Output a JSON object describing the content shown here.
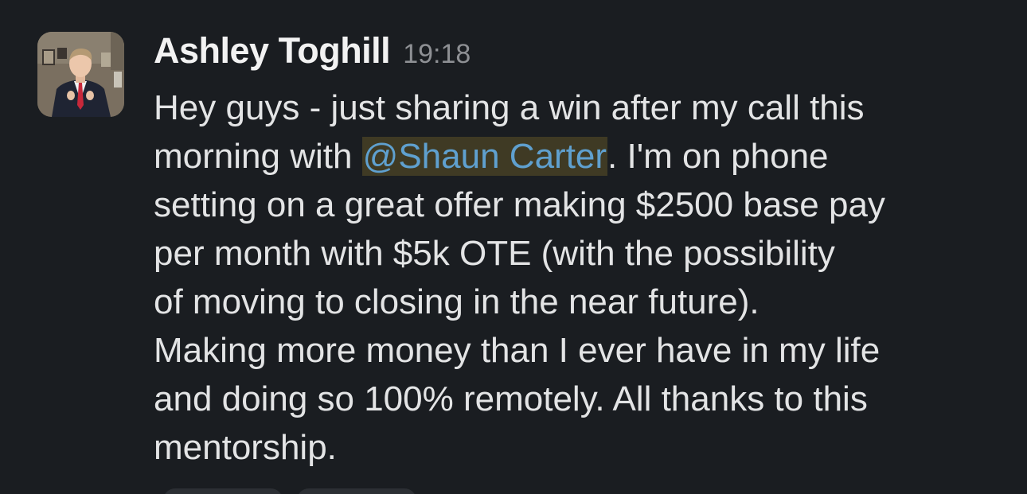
{
  "message": {
    "author": "Ashley Toghill",
    "timestamp": "19:18",
    "lines": [
      {
        "text": "Hey guys - just sharing a win after my call this"
      },
      {
        "before": "morning with ",
        "mention": "@Shaun Carter",
        "after": ". I'm on phone"
      },
      {
        "text": "setting on a great offer making $2500 base pay"
      },
      {
        "text": "per month with $5k OTE (with the possibility"
      },
      {
        "text": "of moving to closing in the near future)."
      },
      {
        "text": "Making more money than I ever have in my life"
      },
      {
        "text": "and doing so 100% remotely. All thanks to this"
      },
      {
        "text": "mentorship."
      }
    ]
  },
  "colors": {
    "background": "#1a1d21",
    "author": "#f2f2f2",
    "timestamp": "#8e9094",
    "text": "#e3e4e5",
    "mention_text": "#5fa0cf",
    "mention_highlight": "#3f3a24"
  }
}
